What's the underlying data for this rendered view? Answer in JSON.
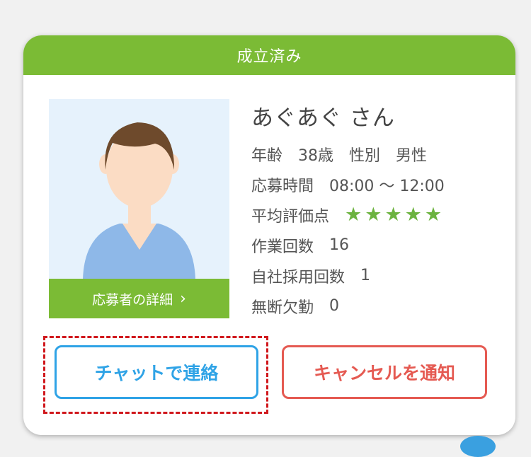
{
  "card": {
    "status": "成立済み",
    "applicant": {
      "name": "あぐあぐ さん",
      "detail_link": "応募者の詳細",
      "age_label": "年齢",
      "age_value": "38歳",
      "gender_label": "性別",
      "gender_value": "男性",
      "apply_time_label": "応募時間",
      "apply_time_value": "08:00 〜 12:00",
      "rating_label": "平均評価点",
      "rating_stars": 5,
      "star_color": "#6cb33f",
      "work_count_label": "作業回数",
      "work_count_value": "16",
      "hire_count_label": "自社採用回数",
      "hire_count_value": "1",
      "absence_label": "無断欠勤",
      "absence_value": "0"
    },
    "buttons": {
      "chat": "チャットで連絡",
      "cancel": "キャンセルを通知"
    }
  },
  "colors": {
    "green": "#7bbb35",
    "blue": "#2fa3e6",
    "red": "#e55a52"
  }
}
